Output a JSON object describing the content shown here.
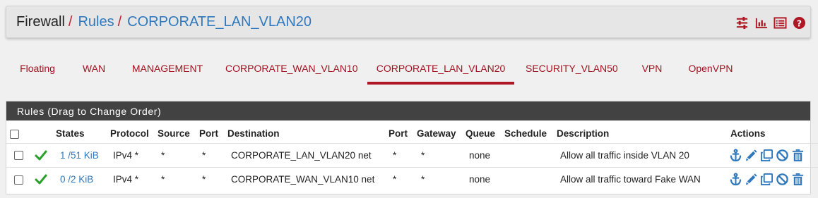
{
  "breadcrumb": {
    "root": "Firewall",
    "sep1": "/",
    "section": "Rules",
    "sep2": "/",
    "current": "CORPORATE_LAN_VLAN20"
  },
  "header_icons": [
    "settings-sliders-icon",
    "bar-chart-icon",
    "list-icon",
    "help-icon"
  ],
  "tabs": [
    {
      "label": "Floating",
      "active": false
    },
    {
      "label": "WAN",
      "active": false
    },
    {
      "label": "MANAGEMENT",
      "active": false
    },
    {
      "label": "CORPORATE_WAN_VLAN10",
      "active": false
    },
    {
      "label": "CORPORATE_LAN_VLAN20",
      "active": true
    },
    {
      "label": "SECURITY_VLAN50",
      "active": false
    },
    {
      "label": "VPN",
      "active": false
    },
    {
      "label": "OpenVPN",
      "active": false
    }
  ],
  "panel": {
    "title": "Rules (Drag to Change Order)",
    "columns": {
      "states": "States",
      "protocol": "Protocol",
      "source": "Source",
      "port": "Port",
      "destination": "Destination",
      "dport": "Port",
      "gateway": "Gateway",
      "queue": "Queue",
      "schedule": "Schedule",
      "description": "Description",
      "actions": "Actions"
    },
    "rows": [
      {
        "states": "1 /51 KiB",
        "protocol": "IPv4 *",
        "source": "*",
        "port": "*",
        "destination": "CORPORATE_LAN_VLAN20 net",
        "dport": "*",
        "gateway": "*",
        "queue": "none",
        "schedule": "",
        "description": "Allow all traffic inside VLAN 20"
      },
      {
        "states": "0 /2 KiB",
        "protocol": "IPv4 *",
        "source": "*",
        "port": "*",
        "destination": "CORPORATE_WAN_VLAN10 net",
        "dport": "*",
        "gateway": "*",
        "queue": "none",
        "schedule": "",
        "description": "Allow all traffic toward Fake WAN"
      }
    ],
    "row_action_icons": [
      "anchor-icon",
      "pencil-icon",
      "copy-icon",
      "disable-icon",
      "trash-icon"
    ]
  },
  "colors": {
    "accent_red": "#b01724",
    "link_blue": "#2f78bd",
    "panel_header": "#424242",
    "pass_green": "#2aa12a"
  }
}
